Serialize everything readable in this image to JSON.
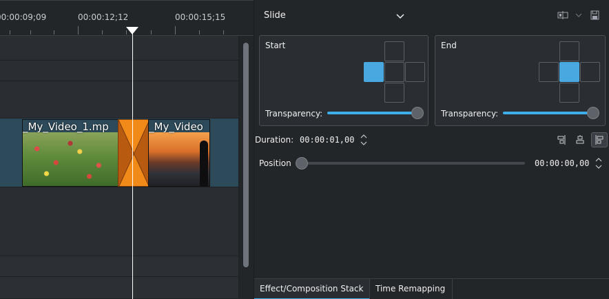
{
  "timeline": {
    "timecodes": [
      "00:00:09;09",
      "00:00:12;12",
      "00:00:15;15"
    ],
    "clips": [
      {
        "label": "_My_Video_1.mp"
      },
      {
        "label": "_My_Video"
      }
    ],
    "transition_color": "#f28a1a",
    "track_color": "#2d4a5a"
  },
  "panel": {
    "composition": {
      "selected": "Slide"
    },
    "start": {
      "title": "Start",
      "transparency_label": "Transparency:",
      "transparency_value": 1.0,
      "selected_cell": "left"
    },
    "end": {
      "title": "End",
      "transparency_label": "Transparency:",
      "transparency_value": 1.0,
      "selected_cell": "center"
    },
    "duration": {
      "label": "Duration:",
      "value": "00:00:01,00"
    },
    "position": {
      "label": "Position",
      "value": "00:00:00,00",
      "fraction": 0.0
    },
    "tabs": [
      {
        "label": "Effect/Composition Stack",
        "active": true
      },
      {
        "label": "Time Remapping",
        "active": false
      }
    ],
    "accent_color": "#3daee9",
    "selected_cell_color": "#4aa8e0"
  }
}
